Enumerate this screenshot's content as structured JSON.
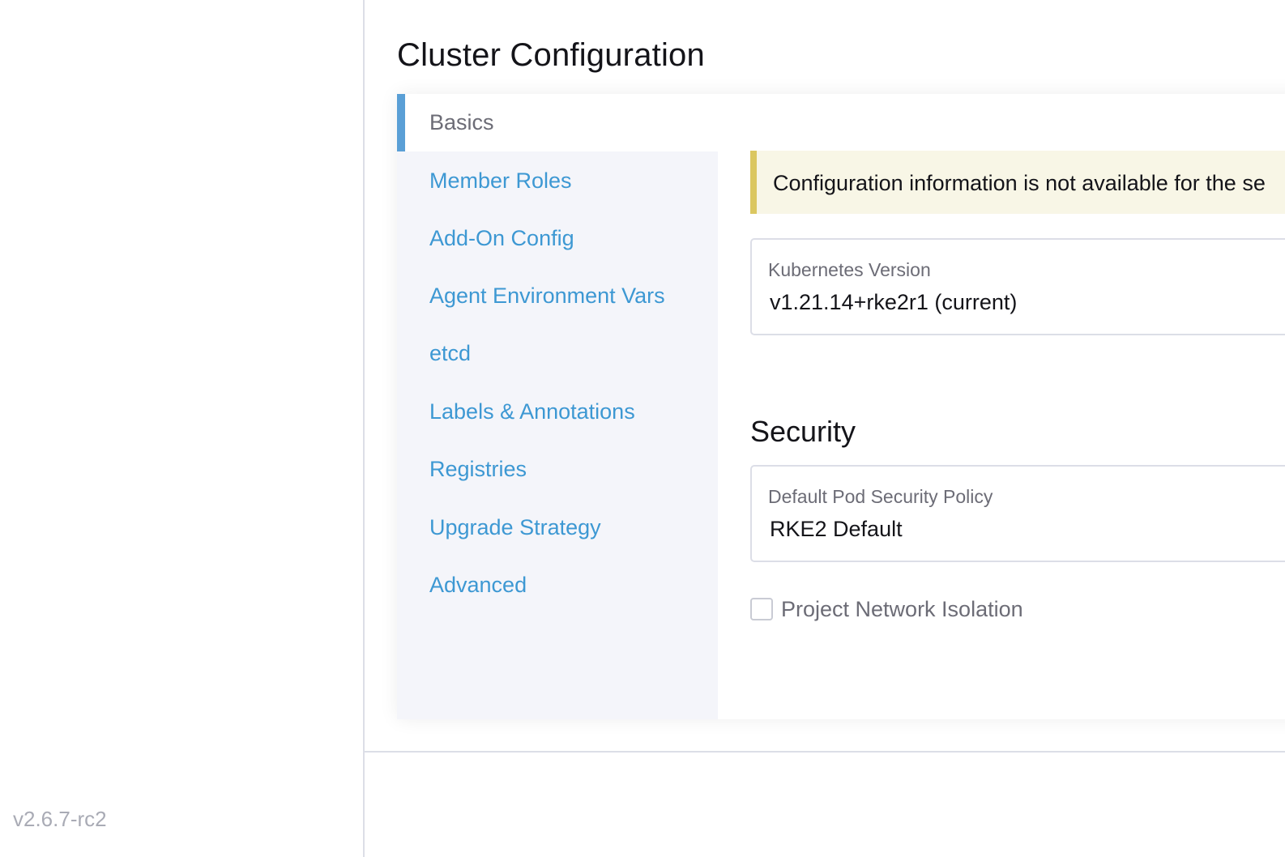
{
  "app": {
    "version": "v2.6.7-rc2"
  },
  "page": {
    "title": "Cluster Configuration"
  },
  "tabs": [
    {
      "label": "Basics",
      "active": true
    },
    {
      "label": "Member Roles",
      "active": false
    },
    {
      "label": "Add-On Config",
      "active": false
    },
    {
      "label": "Agent Environment Vars",
      "active": false
    },
    {
      "label": "etcd",
      "active": false
    },
    {
      "label": "Labels & Annotations",
      "active": false
    },
    {
      "label": "Registries",
      "active": false
    },
    {
      "label": "Upgrade Strategy",
      "active": false
    },
    {
      "label": "Advanced",
      "active": false
    }
  ],
  "banner": {
    "text": "Configuration information is not available for the se"
  },
  "kubernetes": {
    "label": "Kubernetes Version",
    "value": "v1.21.14+rke2r1 (current)"
  },
  "security": {
    "title": "Security",
    "psp_label": "Default Pod Security Policy",
    "psp_value": "RKE2 Default",
    "network_isolation_label": "Project Network Isolation",
    "network_isolation_checked": false
  },
  "colors": {
    "link": "#3d98d3",
    "active_tab_bar": "#5a9fd6",
    "banner_bg": "#f8f6e6",
    "banner_bar": "#dbc760"
  }
}
